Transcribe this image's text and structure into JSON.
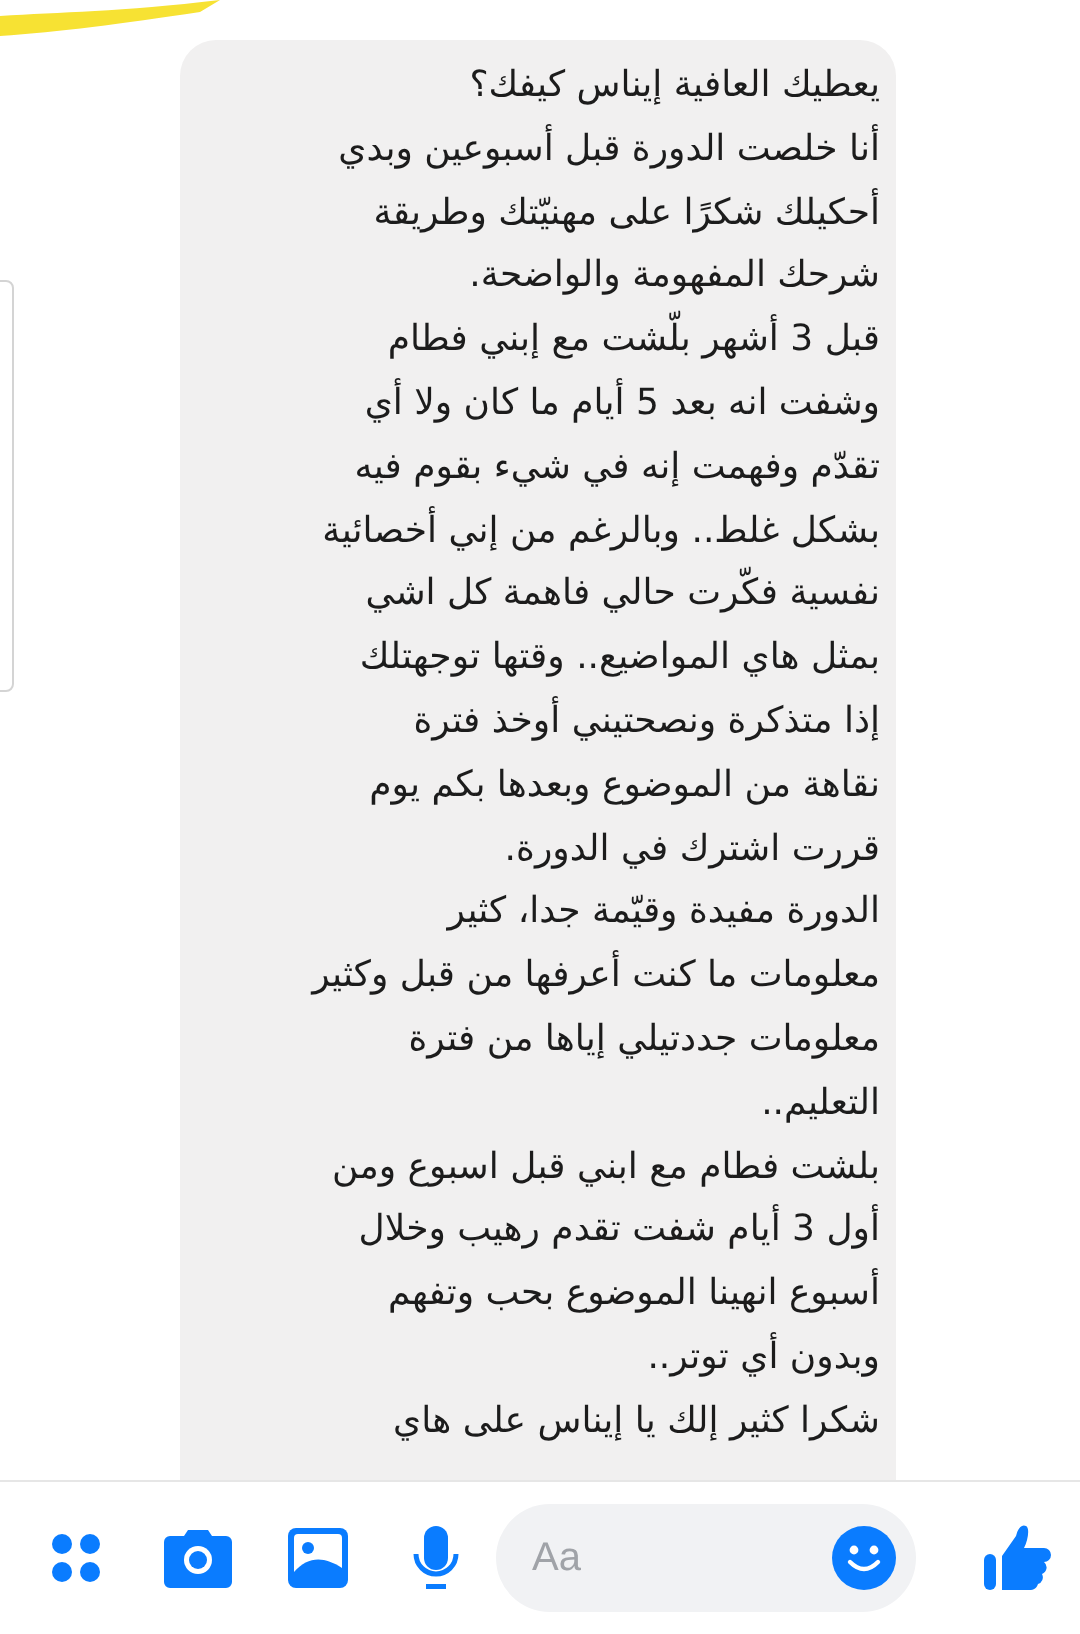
{
  "message": {
    "lines": [
      "يعطيك العافية إيناس كيفك؟",
      "أنا خلصت الدورة قبل أسبوعين وبدي",
      "أحكيلك شكرًا على مهنيّتك وطريقة",
      "شرحك المفهومة والواضحة.",
      "قبل 3 أشهر بلّشت مع إبني فطام",
      "وشفت انه بعد 5 أيام ما كان ولا أي",
      "تقدّم وفهمت إنه في شيء بقوم فيه",
      "بشكل غلط.. وبالرغم من إني أخصائية",
      "نفسية فكّرت حالي فاهمة كل اشي",
      "بمثل هاي المواضيع.. وقتها توجهتلك",
      "إذا متذكرة ونصحتيني أوخذ فترة",
      "نقاهة من الموضوع وبعدها بكم يوم",
      "قررت اشترك في الدورة.",
      "الدورة مفيدة وقيّمة جدا، كثير",
      "معلومات ما كنت أعرفها من قبل وكثير",
      "معلومات جددتيلي إياها من فترة",
      "التعليم..",
      "بلشت فطام مع ابني قبل اسبوع ومن",
      "أول 3 أيام شفت تقدم رهيب وخلال",
      "أسبوع انهينا الموضوع بحب وتفهم",
      "وبدون أي توتر..",
      "شكرا كثير إلك يا إيناس على هاي"
    ]
  },
  "composer": {
    "placeholder": "Aa"
  }
}
